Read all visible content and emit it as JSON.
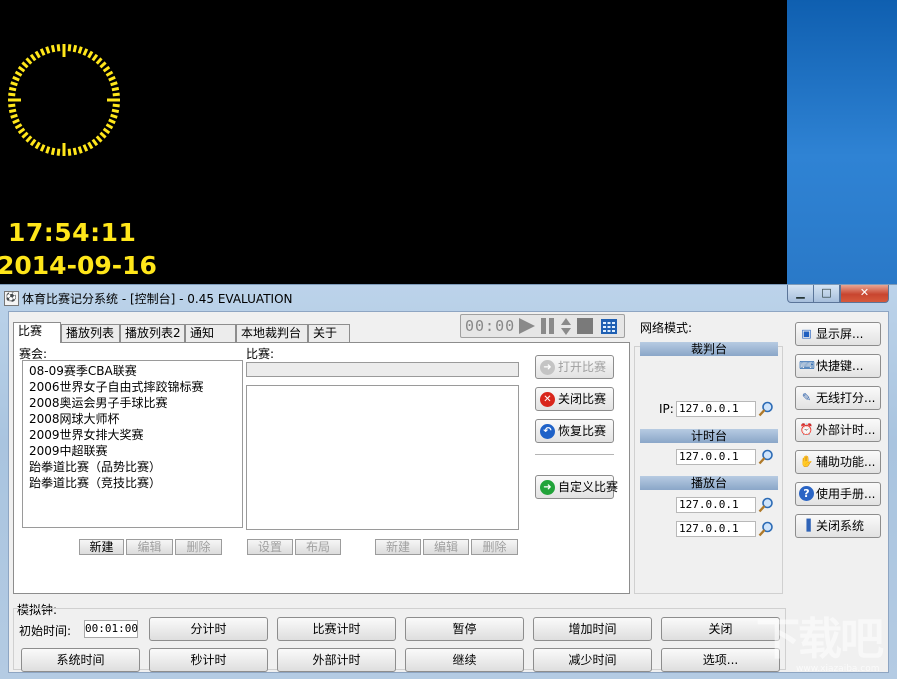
{
  "display": {
    "time": "17:54:11",
    "date": "2014-09-16"
  },
  "window": {
    "title": "体育比赛记分系统 - [控制台] - 0.45 EVALUATION",
    "minimize_icon": "minimize-icon",
    "maximize_icon": "maximize-icon",
    "close_icon": "close-icon"
  },
  "tabs": [
    "比赛",
    "播放列表",
    "播放列表2",
    "通知",
    "本地裁判台",
    "关于"
  ],
  "media": {
    "time": "00:00"
  },
  "league": {
    "label": "赛会:",
    "items": [
      "08-09赛季CBA联赛",
      "2006世界女子自由式摔跤锦标赛",
      "2008奥运会男子手球比赛",
      "2008网球大师杯",
      "2009世界女排大奖赛",
      "2009中超联赛",
      "跆拳道比赛（品势比赛）",
      "跆拳道比赛（竞技比赛）"
    ],
    "btn_new": "新建",
    "btn_edit": "编辑",
    "btn_delete": "删除"
  },
  "match": {
    "label": "比赛:",
    "btn_settings": "设置",
    "btn_layout": "布局",
    "btn_new": "新建",
    "btn_edit": "编辑",
    "btn_delete": "删除"
  },
  "actions": {
    "open": "打开比赛",
    "close": "关闭比赛",
    "restore": "恢复比赛",
    "custom": "自定义比赛"
  },
  "network": {
    "label": "网络模式:",
    "referee_head": "裁判台",
    "ip_label": "IP:",
    "referee_ip": "127.0.0.1",
    "timer_head": "计时台",
    "timer_ip": "127.0.0.1",
    "play_head": "播放台",
    "play_ip1": "127.0.0.1",
    "play_ip2": "127.0.0.1"
  },
  "side": {
    "display": "显示屏...",
    "shortcut": "快捷键...",
    "wireless": "无线打分...",
    "external_timer": "外部计时...",
    "aux": "辅助功能...",
    "manual": "使用手册...",
    "exit": "关闭系统"
  },
  "sim": {
    "label": "模拟钟:",
    "init_label": "初始时间:",
    "init_value": "00:01:00",
    "row1": [
      "分计时",
      "比赛计时",
      "暂停",
      "增加时间",
      "关闭"
    ],
    "row2": [
      "系统时间",
      "秒计时",
      "外部计时",
      "继续",
      "减少时间",
      "选项..."
    ]
  },
  "watermark": {
    "text": "下载吧",
    "url": "www.xiazaiba.com"
  },
  "colors": {
    "display_yellow": "#ffe61a",
    "net_head": "#9fb7d4"
  }
}
